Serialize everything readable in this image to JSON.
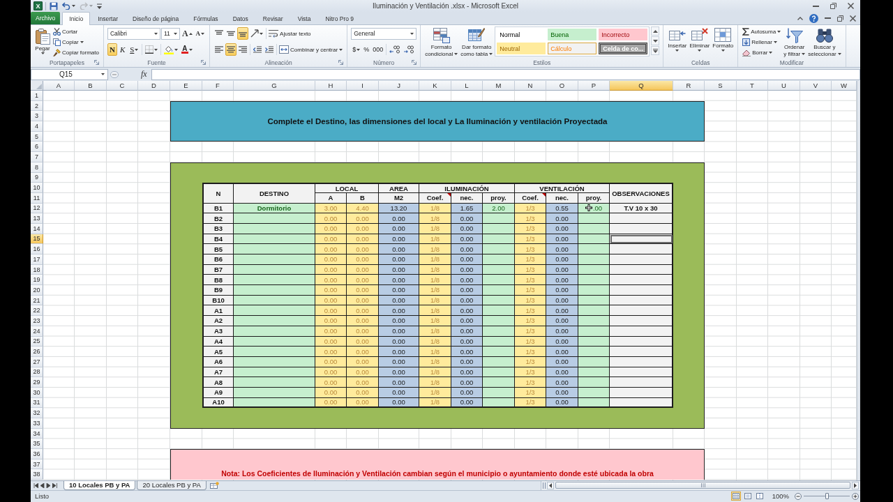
{
  "window": {
    "title": "Iluminación y Ventilación .xlsx - Microsoft Excel",
    "logo": "X"
  },
  "quick_access": [
    {
      "kind": "save",
      "disabled": false
    },
    {
      "kind": "undo",
      "disabled": false
    },
    {
      "kind": "redo",
      "disabled": true
    },
    {
      "kind": "customize",
      "disabled": false
    }
  ],
  "ribbon_tabs": [
    {
      "label": "Archivo",
      "kind": "file",
      "selected": false
    },
    {
      "label": "Inicio",
      "kind": "tab",
      "selected": true
    },
    {
      "label": "Insertar",
      "kind": "tab",
      "selected": false
    },
    {
      "label": "Diseño de página",
      "kind": "tab",
      "selected": false
    },
    {
      "label": "Fórmulas",
      "kind": "tab",
      "selected": false
    },
    {
      "label": "Datos",
      "kind": "tab",
      "selected": false
    },
    {
      "label": "Revisar",
      "kind": "tab",
      "selected": false
    },
    {
      "label": "Vista",
      "kind": "tab",
      "selected": false
    },
    {
      "label": "Nitro Pro 9",
      "kind": "tab",
      "selected": false
    }
  ],
  "ribbon": {
    "clipboard": {
      "label": "Portapapeles",
      "paste": "Pegar",
      "cut": "Cortar",
      "copy": "Copiar",
      "format_painter": "Copiar formato"
    },
    "font": {
      "label": "Fuente",
      "font_name": "Calibri",
      "font_size": "11",
      "grow": "A",
      "shrink": "A",
      "styles": [
        {
          "label": "N",
          "kind": "bold",
          "selected": true
        },
        {
          "label": "K",
          "kind": "italic",
          "selected": false
        },
        {
          "label": "S",
          "kind": "underline",
          "selected": false
        }
      ],
      "font_color": "A"
    },
    "alignment": {
      "label": "Alineación",
      "vertical": [
        {
          "kind": "top",
          "selected": false
        },
        {
          "kind": "middle",
          "selected": false
        },
        {
          "kind": "bottom",
          "selected": true
        }
      ],
      "horizontal": [
        {
          "kind": "left",
          "selected": false
        },
        {
          "kind": "center",
          "selected": true
        },
        {
          "kind": "right",
          "selected": false
        }
      ],
      "wrap_text": "Ajustar texto",
      "merge_center": "Combinar y centrar"
    },
    "number": {
      "label": "Número",
      "format": "General",
      "currency": "$",
      "percent": "%",
      "thousands": "000"
    },
    "styles": {
      "label": "Estilos",
      "conditional_format": [
        "Formato",
        "condicional"
      ],
      "format_as_table": [
        "Dar formato",
        "como tabla"
      ],
      "gallery": [
        {
          "label": "Normal",
          "kind": "normal",
          "color": "#ffffff"
        },
        {
          "label": "Buena",
          "kind": "good",
          "color": "#c6efce"
        },
        {
          "label": "Incorrecto",
          "kind": "bad",
          "color": "#ffc7ce"
        },
        {
          "label": "Neutral",
          "kind": "neutral",
          "color": "#ffeb9c"
        },
        {
          "label": "Cálculo",
          "kind": "calculation",
          "color": "#f2f2f2"
        },
        {
          "label": "Celda de co...",
          "kind": "check",
          "color": "#a5a5a5"
        }
      ]
    },
    "cells": {
      "label": "Celdas",
      "buttons": [
        {
          "label": "Insertar",
          "kind": "insert"
        },
        {
          "label": "Eliminar",
          "kind": "delete"
        },
        {
          "label": "Formato",
          "kind": "format"
        }
      ]
    },
    "editing": {
      "label": "Modificar",
      "autosum": "Autosuma",
      "fill": "Rellenar",
      "clear": "Borrar",
      "sort_filter": [
        "Ordenar",
        "y filtrar"
      ],
      "find_select": [
        "Buscar y",
        "seleccionar"
      ]
    }
  },
  "formula_bar": {
    "name_box": "Q15",
    "function_button": "fx"
  },
  "sheet_columns": [
    {
      "label": "A",
      "selected": false
    },
    {
      "label": "B",
      "selected": false
    },
    {
      "label": "C",
      "selected": false
    },
    {
      "label": "D",
      "selected": false
    },
    {
      "label": "E",
      "selected": false
    },
    {
      "label": "F",
      "selected": false
    },
    {
      "label": "G",
      "selected": false
    },
    {
      "label": "H",
      "selected": false
    },
    {
      "label": "I",
      "selected": false
    },
    {
      "label": "J",
      "selected": false
    },
    {
      "label": "K",
      "selected": false
    },
    {
      "label": "L",
      "selected": false
    },
    {
      "label": "M",
      "selected": false
    },
    {
      "label": "N",
      "selected": false
    },
    {
      "label": "O",
      "selected": false
    },
    {
      "label": "P",
      "selected": false
    },
    {
      "label": "Q",
      "selected": true
    },
    {
      "label": "R",
      "selected": false
    },
    {
      "label": "S",
      "selected": false
    },
    {
      "label": "T",
      "selected": false
    },
    {
      "label": "U",
      "selected": false
    },
    {
      "label": "V",
      "selected": false
    },
    {
      "label": "W",
      "selected": false
    }
  ],
  "sheet_rows": [
    {
      "label": "1",
      "selected": false
    },
    {
      "label": "2",
      "selected": false
    },
    {
      "label": "3",
      "selected": false
    },
    {
      "label": "4",
      "selected": false
    },
    {
      "label": "5",
      "selected": false
    },
    {
      "label": "6",
      "selected": false
    },
    {
      "label": "7",
      "selected": false
    },
    {
      "label": "8",
      "selected": false
    },
    {
      "label": "9",
      "selected": false
    },
    {
      "label": "10",
      "selected": false
    },
    {
      "label": "11",
      "selected": false
    },
    {
      "label": "12",
      "selected": false
    },
    {
      "label": "13",
      "selected": false
    },
    {
      "label": "14",
      "selected": false
    },
    {
      "label": "15",
      "selected": true
    },
    {
      "label": "16",
      "selected": false
    },
    {
      "label": "17",
      "selected": false
    },
    {
      "label": "18",
      "selected": false
    },
    {
      "label": "19",
      "selected": false
    },
    {
      "label": "20",
      "selected": false
    },
    {
      "label": "21",
      "selected": false
    },
    {
      "label": "22",
      "selected": false
    },
    {
      "label": "23",
      "selected": false
    },
    {
      "label": "24",
      "selected": false
    },
    {
      "label": "25",
      "selected": false
    },
    {
      "label": "26",
      "selected": false
    },
    {
      "label": "27",
      "selected": false
    },
    {
      "label": "28",
      "selected": false
    },
    {
      "label": "29",
      "selected": false
    },
    {
      "label": "30",
      "selected": false
    },
    {
      "label": "31",
      "selected": false
    },
    {
      "label": "32",
      "selected": false
    },
    {
      "label": "33",
      "selected": false
    },
    {
      "label": "34",
      "selected": false
    },
    {
      "label": "35",
      "selected": false
    },
    {
      "label": "36",
      "selected": false
    },
    {
      "label": "37",
      "selected": false
    },
    {
      "label": "38",
      "selected": false
    }
  ],
  "banner": {
    "text": "Complete el Destino, las dimensiones del local y La Iluminación y ventilación Proyectada"
  },
  "table": {
    "columns": [
      {
        "header": "N",
        "kind": "key",
        "comment": false
      },
      {
        "header": "DESTINO",
        "kind": "name",
        "comment": false
      },
      {
        "header": "LOCAL",
        "subheader": "A",
        "kind": "input",
        "comment": false
      },
      {
        "subheader": "B",
        "kind": "input",
        "comment": false
      },
      {
        "header": "AREA",
        "subheader": "M2",
        "kind": "calc",
        "comment": false
      },
      {
        "header": "ILUMINACIÓN",
        "subheader": "Coef.",
        "kind": "input",
        "comment": true
      },
      {
        "subheader": "nec.",
        "kind": "calc",
        "comment": false
      },
      {
        "subheader": "proy.",
        "kind": "entry",
        "comment": false
      },
      {
        "header": "VENTILACIÓN",
        "subheader": "Coef.",
        "kind": "input",
        "comment": true
      },
      {
        "subheader": "nec.",
        "kind": "calc",
        "comment": false
      },
      {
        "subheader": "proy.",
        "kind": "entry",
        "comment": false
      },
      {
        "header": "OBSERVACIONES",
        "kind": "note",
        "comment": false
      }
    ],
    "rows": [
      [
        "B1",
        "Dormitorio",
        "3.00",
        "4.40",
        "13.20",
        "1/8",
        "1.65",
        "2.00",
        "1/3",
        "0.55",
        ".00",
        "T.V 10 x 30"
      ],
      [
        "B2",
        null,
        "0.00",
        "0.00",
        "0.00",
        "1/8",
        "0.00",
        null,
        "1/3",
        "0.00",
        null,
        null
      ],
      [
        "B3",
        null,
        "0.00",
        "0.00",
        "0.00",
        "1/8",
        "0.00",
        null,
        "1/3",
        "0.00",
        null,
        null
      ],
      [
        "B4",
        null,
        "0.00",
        "0.00",
        "0.00",
        "1/8",
        "0.00",
        null,
        "1/3",
        "0.00",
        null,
        null
      ],
      [
        "B5",
        null,
        "0.00",
        "0.00",
        "0.00",
        "1/8",
        "0.00",
        null,
        "1/3",
        "0.00",
        null,
        null
      ],
      [
        "B6",
        null,
        "0.00",
        "0.00",
        "0.00",
        "1/8",
        "0.00",
        null,
        "1/3",
        "0.00",
        null,
        null
      ],
      [
        "B7",
        null,
        "0.00",
        "0.00",
        "0.00",
        "1/8",
        "0.00",
        null,
        "1/3",
        "0.00",
        null,
        null
      ],
      [
        "B8",
        null,
        "0.00",
        "0.00",
        "0.00",
        "1/8",
        "0.00",
        null,
        "1/3",
        "0.00",
        null,
        null
      ],
      [
        "B9",
        null,
        "0.00",
        "0.00",
        "0.00",
        "1/8",
        "0.00",
        null,
        "1/3",
        "0.00",
        null,
        null
      ],
      [
        "B10",
        null,
        "0.00",
        "0.00",
        "0.00",
        "1/8",
        "0.00",
        null,
        "1/3",
        "0.00",
        null,
        null
      ],
      [
        "A1",
        null,
        "0.00",
        "0.00",
        "0.00",
        "1/8",
        "0.00",
        null,
        "1/3",
        "0.00",
        null,
        null
      ],
      [
        "A2",
        null,
        "0.00",
        "0.00",
        "0.00",
        "1/8",
        "0.00",
        null,
        "1/3",
        "0.00",
        null,
        null
      ],
      [
        "A3",
        null,
        "0.00",
        "0.00",
        "0.00",
        "1/8",
        "0.00",
        null,
        "1/3",
        "0.00",
        null,
        null
      ],
      [
        "A4",
        null,
        "0.00",
        "0.00",
        "0.00",
        "1/8",
        "0.00",
        null,
        "1/3",
        "0.00",
        null,
        null
      ],
      [
        "A5",
        null,
        "0.00",
        "0.00",
        "0.00",
        "1/8",
        "0.00",
        null,
        "1/3",
        "0.00",
        null,
        null
      ],
      [
        "A6",
        null,
        "0.00",
        "0.00",
        "0.00",
        "1/8",
        "0.00",
        null,
        "1/3",
        "0.00",
        null,
        null
      ],
      [
        "A7",
        null,
        "0.00",
        "0.00",
        "0.00",
        "1/8",
        "0.00",
        null,
        "1/3",
        "0.00",
        null,
        null
      ],
      [
        "A8",
        null,
        "0.00",
        "0.00",
        "0.00",
        "1/8",
        "0.00",
        null,
        "1/3",
        "0.00",
        null,
        null
      ],
      [
        "A9",
        null,
        "0.00",
        "0.00",
        "0.00",
        "1/8",
        "0.00",
        null,
        "1/3",
        "0.00",
        null,
        null
      ],
      [
        "A10",
        null,
        "0.00",
        "0.00",
        "0.00",
        "1/8",
        "0.00",
        null,
        "1/3",
        "0.00",
        null,
        null
      ]
    ]
  },
  "note": {
    "text": "Nota: Los Coeficientes de Iluminación y Ventilación cambian según el municipio o ayuntamiento donde esté ubicada la obra"
  },
  "sheet_tabs": [
    {
      "label": "10 Locales PB y PA",
      "selected": true
    },
    {
      "label": "20 Locales PB y PA",
      "selected": false
    }
  ],
  "status_bar": {
    "status": "Listo",
    "views": [
      {
        "kind": "normal",
        "selected": true
      },
      {
        "kind": "page_layout",
        "selected": false
      },
      {
        "kind": "page_break",
        "selected": false
      }
    ],
    "zoom": "100%",
    "zoom_slider": {
      "level": 0.5
    }
  }
}
